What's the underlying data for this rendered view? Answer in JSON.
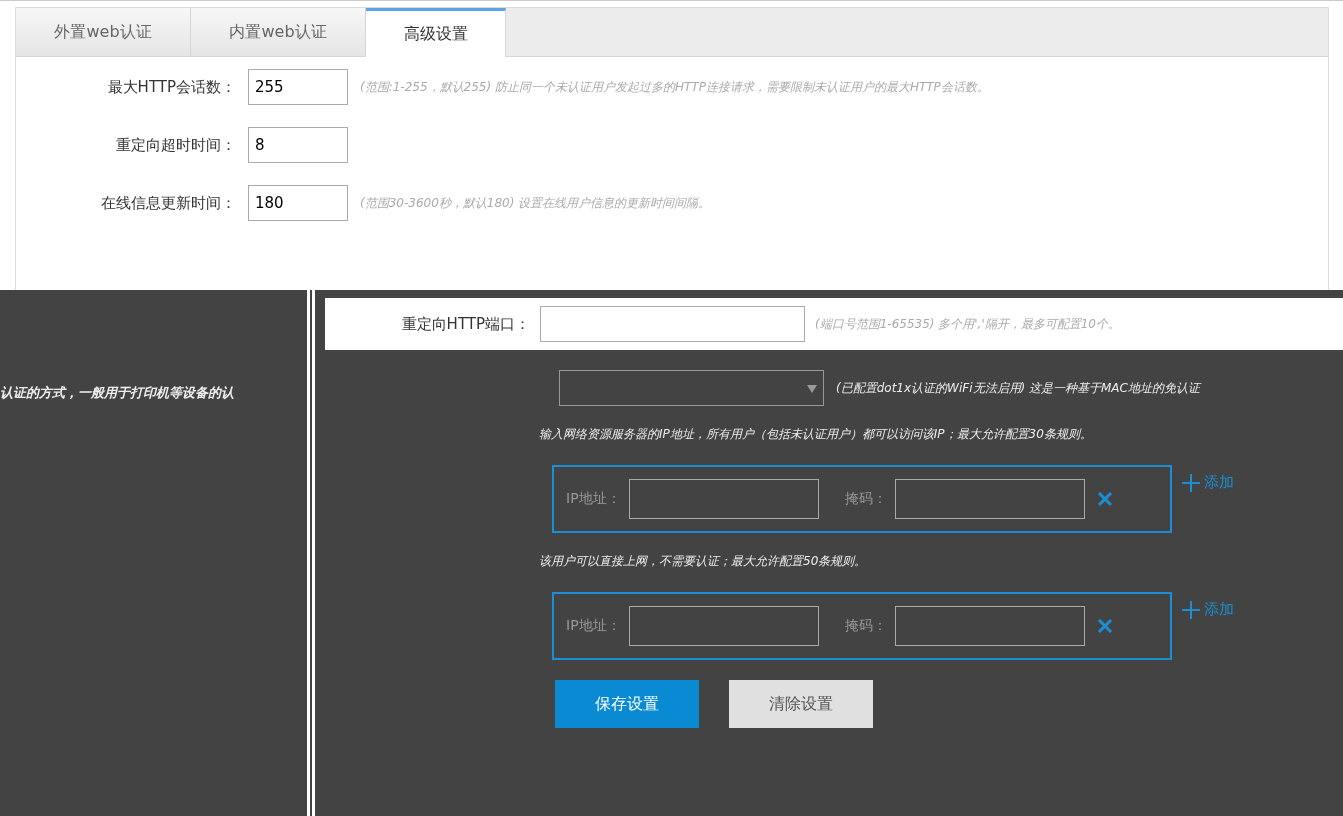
{
  "tabs": [
    {
      "label": "外置web认证",
      "selected": false
    },
    {
      "label": "内置web认证",
      "selected": false
    },
    {
      "label": "高级设置",
      "selected": true
    }
  ],
  "top_rows": [
    {
      "label": "最大HTTP会话数：",
      "value": "255",
      "hint": "(范围:1-255，默认255) 防止同一个未认证用户发起过多的HTTP连接请求，需要限制未认证用户的最大HTTP会话数。"
    },
    {
      "label": "重定向超时时间：",
      "value": "8"
    },
    {
      "label": "在线信息更新时间：",
      "value": "180",
      "hint": "(范围30-3600秒，默认180) 设置在线用户信息的更新时间间隔。"
    }
  ],
  "side_note": "认证的方式，一般用于打印机等设备的认",
  "rows": [
    {
      "kind": "text",
      "label": "重定向HTTP端口：",
      "value": "",
      "hint": "(端口号范围1-65535) 多个用','隔开，最多可配置10个。"
    },
    {
      "kind": "select",
      "hint": "(已配置dot1x认证的WiFi无法启用) 这是一种基于MAC地址的免认证"
    },
    {
      "kind": "rules",
      "hint": "输入网络资源服务器的IP地址，所有用户（包括未认证用户）都可以访问该IP；最大允许配置30条规则。",
      "ip_label": "IP地址：",
      "mask_label": "掩码：",
      "add": "添加"
    },
    {
      "kind": "rules",
      "hint": "该用户可以直接上网，不需要认证；最大允许配置50条规则。",
      "ip_label": "IP地址：",
      "mask_label": "掩码：",
      "add": "添加"
    }
  ],
  "buttons": [
    {
      "label": "保存设置",
      "primary": true
    },
    {
      "label": "清除设置",
      "primary": false
    }
  ]
}
